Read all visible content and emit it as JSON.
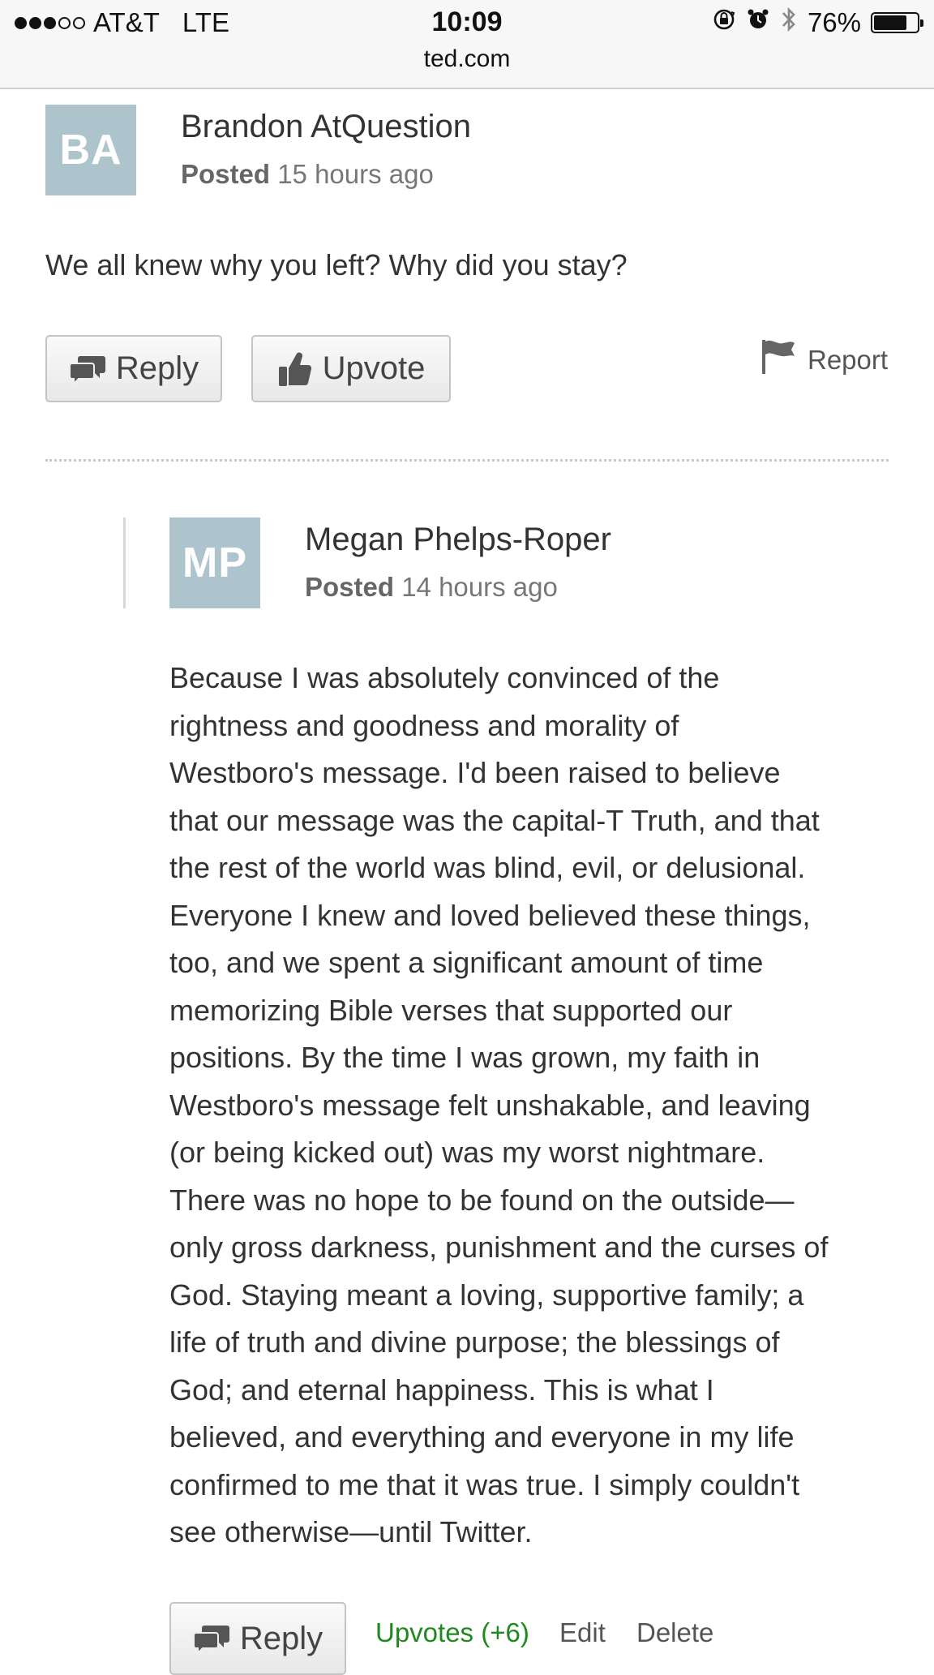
{
  "status_bar": {
    "carrier": "AT&T",
    "network": "LTE",
    "time": "10:09",
    "battery": "76%",
    "battery_level": 0.76,
    "signal_bars_filled": 3,
    "signal_bars_total": 5,
    "icons": [
      "rotation-lock-icon",
      "alarm-icon",
      "bluetooth-icon",
      "battery-icon"
    ]
  },
  "browser": {
    "url": "ted.com"
  },
  "comments": [
    {
      "initials": "BA",
      "author": "Brandon AtQuestion",
      "posted_label": "Posted",
      "posted_time": "15 hours ago",
      "body": "We all knew why you left? Why did you stay?",
      "reply_label": "Reply",
      "upvote_label": "Upvote",
      "report_label": "Report"
    },
    {
      "initials": "MP",
      "author": "Megan Phelps-Roper",
      "posted_label": "Posted",
      "posted_time": "14 hours ago",
      "body_lines": [
        "Because I was absolutely convinced of the",
        "rightness and goodness and morality of",
        "Westboro's message. I'd been raised to believe",
        "that our message was the capital-T Truth, and that",
        "the rest of the world was blind, evil, or delusional.",
        "Everyone I knew and loved believed these things,",
        "too, and we spent a significant amount of time",
        "memorizing Bible verses that supported our",
        "positions. By the time I was grown, my faith in",
        "Westboro's message felt unshakable, and leaving",
        "(or being kicked out) was my worst nightmare.",
        "There was no hope to be found on the outside—",
        "only gross darkness, punishment and the curses of",
        "God. Staying meant a loving, supportive family; a",
        "life of truth and divine purpose; the blessings of",
        "God; and eternal happiness. This is what I",
        "believed, and everything and everyone in my life",
        "confirmed to me that it was true. I simply couldn't",
        "see otherwise—until Twitter."
      ],
      "reply_label": "Reply",
      "upvotes_label": "Upvotes (+6)",
      "edit_label": "Edit",
      "delete_label": "Delete"
    }
  ],
  "colors": {
    "avatar_bg": "#aec4cc",
    "upvotes_green": "#1e8a1e",
    "text": "#333333",
    "muted": "#777777"
  }
}
